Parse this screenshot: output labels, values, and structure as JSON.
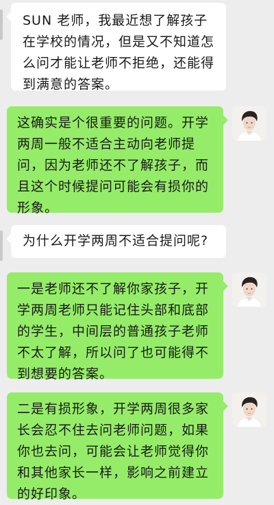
{
  "conversation": {
    "messages": [
      {
        "side": "received",
        "text": "SUN 老师，我最近想了解孩子在学校的情况，但是又不知道怎么问才能让老师不拒绝，还能得到满意的答案。"
      },
      {
        "side": "sent",
        "text": "这确实是个很重要的问题。开学两周一般不适合主动向老师提问，因为老师还不了解孩子，而且这个时候提问可能会有损你的形象。"
      },
      {
        "side": "received",
        "text": "为什么开学两周不适合提问呢?"
      },
      {
        "side": "sent",
        "text": "一是老师还不了解你家孩子，开学两周老师只能记住头部和底部的学生，中间层的普通孩子老师不太了解，所以问了也可能得不到想要的答案。"
      },
      {
        "side": "sent",
        "text": "二是有损形象，开学两周很多家长会忍不住去问老师问题，如果你也去问，可能会让老师觉得你和其他家长一样，影响之前建立的好印象。"
      }
    ]
  },
  "colors": {
    "background": "#ededed",
    "received_bubble": "#ffffff",
    "sent_bubble": "#95ec69",
    "text": "#191919"
  }
}
